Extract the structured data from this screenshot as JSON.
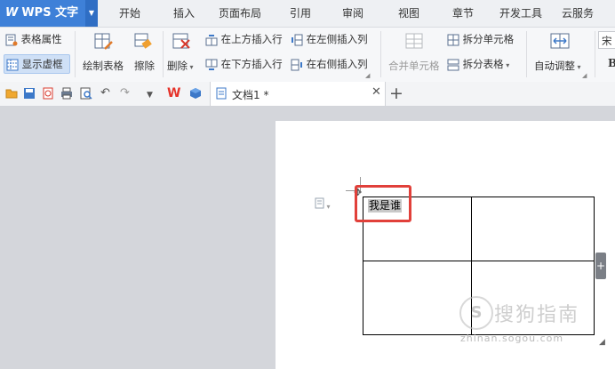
{
  "app": {
    "name": "WPS 文字"
  },
  "menu": {
    "tabs": [
      "开始",
      "插入",
      "页面布局",
      "引用",
      "审阅",
      "视图",
      "章节",
      "开发工具",
      "云服务"
    ]
  },
  "ribbon": {
    "table_properties": "表格属性",
    "show_gridlines": "显示虚框",
    "draw_table": "绘制表格",
    "eraser": "擦除",
    "delete": "删除",
    "insert_row_above": "在上方插入行",
    "insert_row_below": "在下方插入行",
    "insert_col_left": "在左侧插入列",
    "insert_col_right": "在右侧插入列",
    "merge_cells": "合并单元格",
    "split_cells": "拆分单元格",
    "split_table": "拆分表格",
    "auto_fit": "自动调整",
    "font_name_partial": "宋",
    "bold": "B"
  },
  "quick_access": {
    "icons": [
      "open-folder-icon",
      "save-icon",
      "export-pdf-icon",
      "print-icon",
      "print-preview-icon",
      "undo-icon",
      "redo-icon"
    ]
  },
  "document": {
    "tab_title": "文档1 *",
    "cell_text": "我是谁"
  },
  "watermark": {
    "logo": "S",
    "text": "搜狗指南",
    "url": "zhinan.sogou.com"
  },
  "colors": {
    "app_blue": "#3e80d8",
    "highlight_red": "#e1403a",
    "wps_red": "#e6332a"
  }
}
